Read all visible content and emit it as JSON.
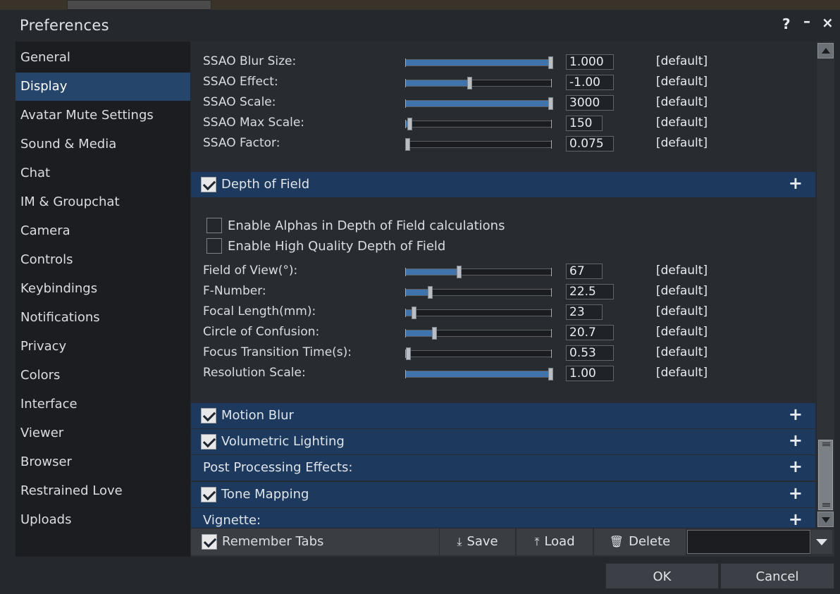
{
  "window": {
    "title": "Preferences",
    "help_label": "?",
    "minimize_label": "–",
    "close_label": "×"
  },
  "sidebar": {
    "items": [
      {
        "label": "General"
      },
      {
        "label": "Display"
      },
      {
        "label": "Avatar Mute Settings"
      },
      {
        "label": "Sound & Media"
      },
      {
        "label": "Chat"
      },
      {
        "label": "IM & Groupchat"
      },
      {
        "label": "Camera"
      },
      {
        "label": "Controls"
      },
      {
        "label": "Keybindings"
      },
      {
        "label": "Notifications"
      },
      {
        "label": "Privacy"
      },
      {
        "label": "Colors"
      },
      {
        "label": "Interface"
      },
      {
        "label": "Viewer"
      },
      {
        "label": "Browser"
      },
      {
        "label": "Restrained Love"
      },
      {
        "label": "Uploads"
      }
    ],
    "active": "Display"
  },
  "ssao": [
    {
      "label": "SSAO Blur Size:",
      "value": "1.000",
      "level": 1.0
    },
    {
      "label": "SSAO Effect:",
      "value": "-1.00",
      "level": 0.44
    },
    {
      "label": "SSAO Scale:",
      "value": "3000",
      "level": 1.0
    },
    {
      "label": "SSAO Max Scale:",
      "value": "150",
      "level": 0.03
    },
    {
      "label": "SSAO Factor:",
      "value": "0.075",
      "level": 0.0
    }
  ],
  "default_label": "[default]",
  "dof": {
    "header": "Depth of Field",
    "checked": true,
    "checkboxes": [
      {
        "label": "Enable Alphas in Depth of Field calculations",
        "checked": false
      },
      {
        "label": "Enable High Quality Depth of Field",
        "checked": false
      }
    ],
    "sliders": [
      {
        "label": "Field of View(°):",
        "value": "67",
        "level": 0.37
      },
      {
        "label": "F-Number:",
        "value": "22.5",
        "level": 0.17
      },
      {
        "label": "Focal Length(mm):",
        "value": "23",
        "level": 0.06
      },
      {
        "label": "Circle of Confusion:",
        "value": "20.7",
        "level": 0.2
      },
      {
        "label": "Focus Transition Time(s):",
        "value": "0.53",
        "level": 0.02
      },
      {
        "label": "Resolution Scale:",
        "value": "1.00",
        "level": 1.0
      }
    ]
  },
  "sections": [
    {
      "header": "Motion Blur",
      "checkbox": true,
      "checked": true
    },
    {
      "header": "Volumetric Lighting",
      "checkbox": true,
      "checked": true
    },
    {
      "header": "Post Processing Effects:",
      "checkbox": false
    },
    {
      "header": "Tone Mapping",
      "checkbox": true,
      "checked": true
    },
    {
      "header": "Vignette:",
      "checkbox": false
    }
  ],
  "expand_label": "+",
  "toolbar": {
    "remember_tabs": "Remember Tabs",
    "remember_checked": true,
    "save": "Save",
    "load": "Load",
    "delete": "Delete"
  },
  "dialog": {
    "ok": "OK",
    "cancel": "Cancel"
  }
}
